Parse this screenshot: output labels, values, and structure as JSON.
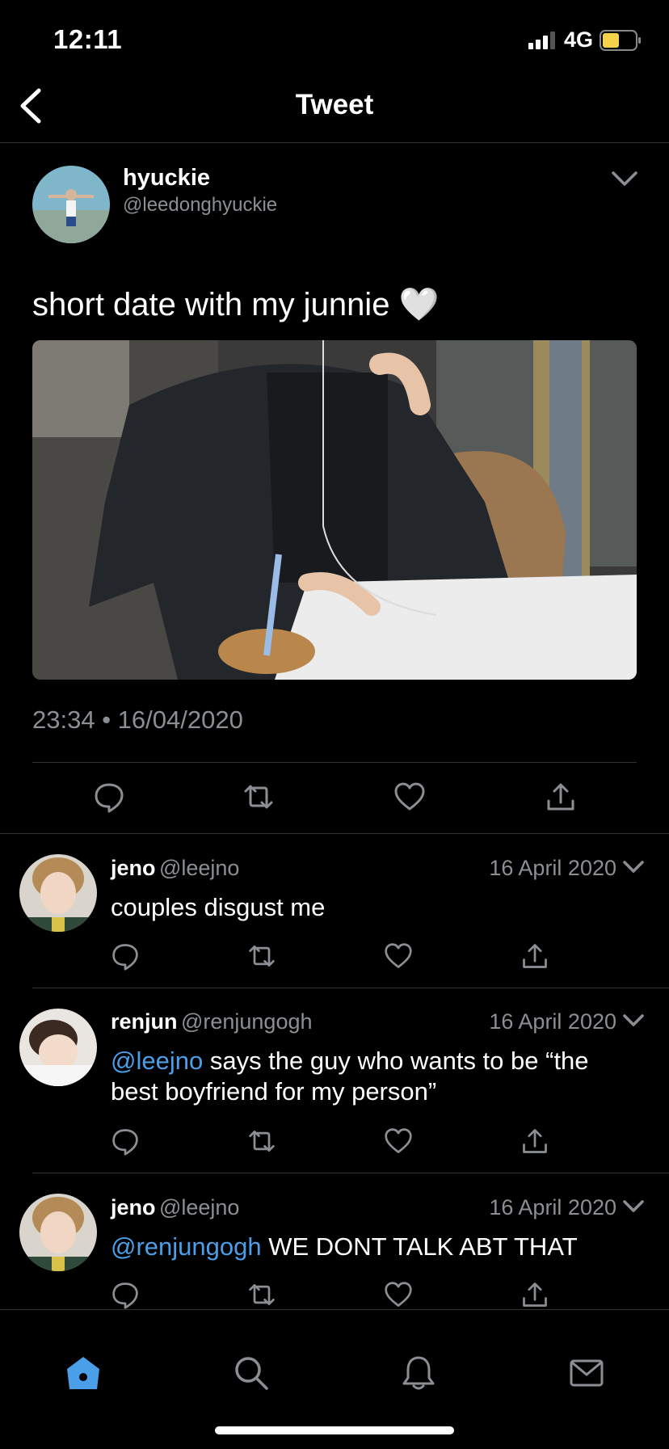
{
  "status_bar": {
    "time": "12:11",
    "network": "4G"
  },
  "nav": {
    "title": "Tweet",
    "back_icon": "chevron-left-icon"
  },
  "tweet": {
    "author_name": "hyuckie",
    "author_handle": "@leedonghyuckie",
    "text": "short date with my junnie 🤍",
    "timestamp": "23:34 • 16/04/2020"
  },
  "replies": [
    {
      "name": "jeno",
      "handle": "@leejno",
      "date": "16 April 2020",
      "mention": "",
      "text": "couples disgust me"
    },
    {
      "name": "renjun",
      "handle": "@renjungogh",
      "date": "16 April 2020",
      "mention": "@leejno",
      "text": " says the guy who wants to be “the best boyfriend for my person”"
    },
    {
      "name": "jeno",
      "handle": "@leejno",
      "date": "16 April 2020",
      "mention": "@renjungogh",
      "text": " WE DONT TALK ABT THAT"
    }
  ],
  "tab_bar": {
    "items": [
      "home-icon",
      "search-icon",
      "bell-icon",
      "mail-icon"
    ]
  },
  "colors": {
    "accent": "#4a9fe8",
    "secondary_text": "#8b8f94",
    "divider": "#2f3336",
    "battery": "#f5d24a"
  }
}
